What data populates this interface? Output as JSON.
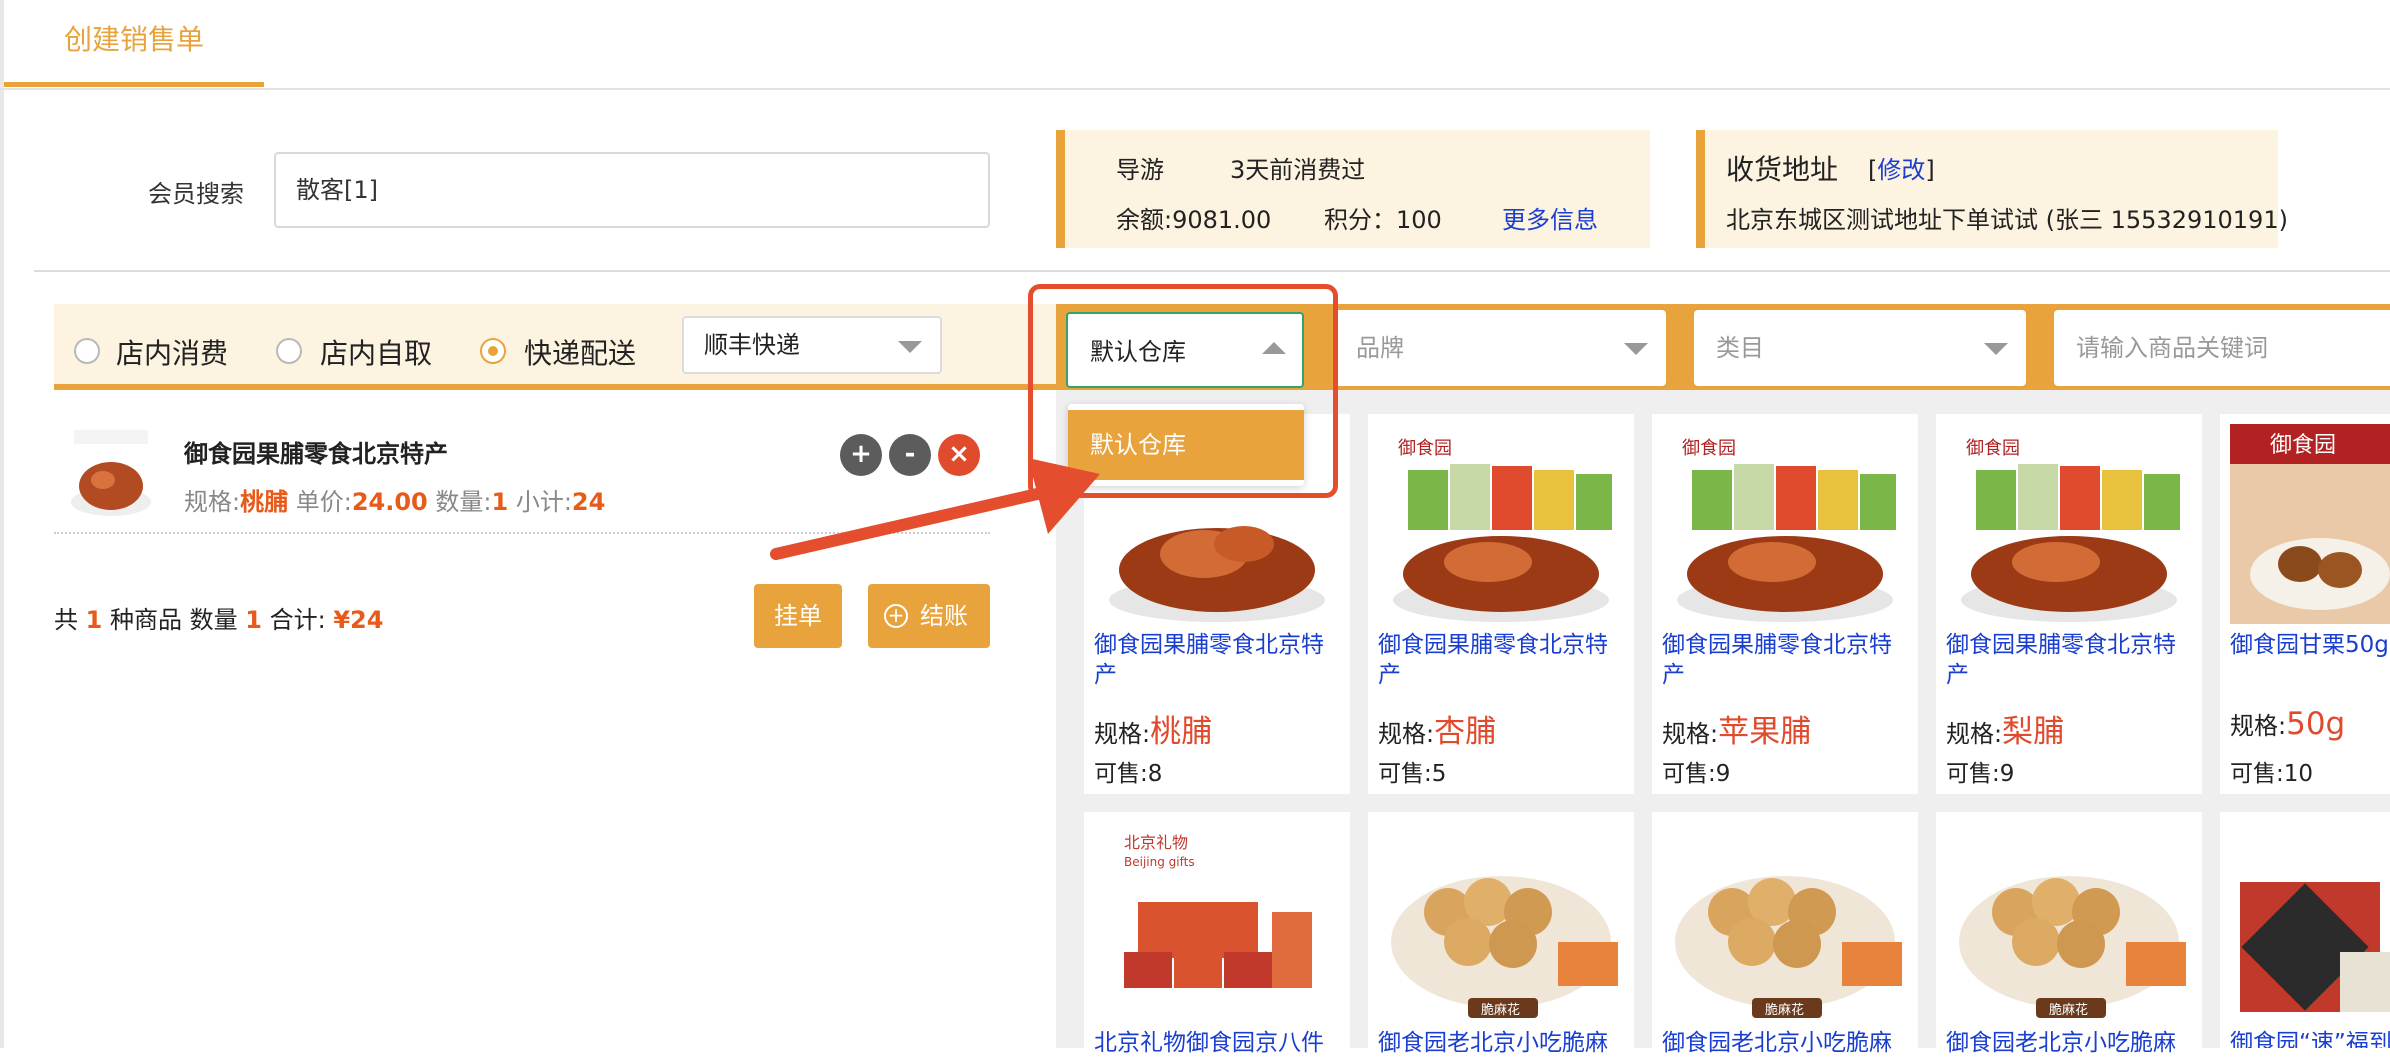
{
  "tab": {
    "title": "创建销售单"
  },
  "member": {
    "label": "会员搜索",
    "value": "散客[1]"
  },
  "guide": {
    "label": "导游",
    "last_visit": "3天前消费过",
    "balance": "余额:9081.00",
    "points": "积分：100",
    "more": "更多信息"
  },
  "address": {
    "title": "收货地址",
    "bracket_open": "[",
    "edit": "修改",
    "bracket_close": "]",
    "text": "北京东城区测试地址下单试试 (张三 15532910191)"
  },
  "delivery": {
    "options": [
      "店内消费",
      "店内自取",
      "快递配送"
    ],
    "selected": "快递配送",
    "courier": "顺丰快递"
  },
  "cart": {
    "item": {
      "name": "御食园果脯零食北京特产",
      "spec_label": "规格:",
      "spec": "桃脯",
      "price_label": "单价:",
      "price": "24.00",
      "qty_label": "数量:",
      "qty": "1",
      "subtotal_label": "小计:",
      "subtotal": "24"
    },
    "buttons": {
      "plus": "+",
      "minus": "-",
      "remove": "×"
    },
    "summary": {
      "prefix": "共",
      "kinds": "1",
      "mid1": "种商品 数量",
      "qty": "1",
      "mid2": "合计:",
      "total": "¥24"
    },
    "hold": "挂单",
    "checkout": "结账"
  },
  "filters": {
    "warehouse": "默认仓库",
    "brand": "品牌",
    "category": "类目",
    "keyword_placeholder": "请输入商品关键词",
    "dropdown_option": "默认仓库"
  },
  "products": [
    {
      "name": "御食园果脯零食北京特产",
      "spec_label": "规格:",
      "spec": "桃脯",
      "stock": "可售:8"
    },
    {
      "name": "御食园果脯零食北京特产",
      "spec_label": "规格:",
      "spec": "杏脯",
      "stock": "可售:5"
    },
    {
      "name": "御食园果脯零食北京特产",
      "spec_label": "规格:",
      "spec": "苹果脯",
      "stock": "可售:9"
    },
    {
      "name": "御食园果脯零食北京特产",
      "spec_label": "规格:",
      "spec": "梨脯",
      "stock": "可售:9"
    },
    {
      "name": "御食园甘栗50g",
      "spec_label": "规格:",
      "spec": "50g",
      "stock": "可售:10"
    }
  ],
  "products_row2": [
    {
      "name": "北京礼物御食园京八件"
    },
    {
      "name": "御食园老北京小吃脆麻"
    },
    {
      "name": "御食园老北京小吃脆麻"
    },
    {
      "name": "御食园老北京小吃脆麻"
    },
    {
      "name": "御食园“速”福到"
    }
  ],
  "brand_marks": {
    "yushiyuan": "御食园",
    "beijing_gifts": "北京礼物",
    "beijing_gifts_en": "Beijing gifts",
    "cuimahua": "脆麻花"
  },
  "colors": {
    "accent": "#e8a33d",
    "link": "#1a3fd0",
    "price": "#e04a2d",
    "highlight": "#e44d2e"
  }
}
